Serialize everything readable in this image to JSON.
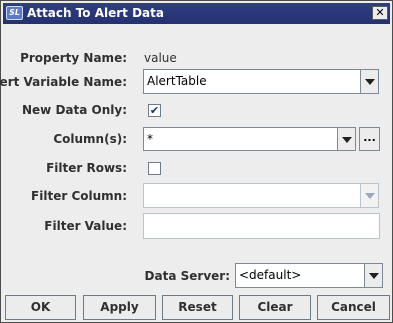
{
  "window": {
    "title": "Attach To Alert Data",
    "app_icon_text": "SL",
    "close_symbol": "✕"
  },
  "form": {
    "property_name_label": "Property Name:",
    "property_name_value": "value",
    "alert_variable_label": "Alert Variable Name:",
    "alert_variable_value": "AlertTable",
    "new_data_only_label": "New Data Only:",
    "new_data_only_checked": true,
    "check_mark": "✔",
    "columns_label": "Column(s):",
    "columns_value": "*",
    "columns_browse": "...",
    "filter_rows_label": "Filter Rows:",
    "filter_rows_checked": false,
    "filter_column_label": "Filter Column:",
    "filter_column_value": "",
    "filter_value_label": "Filter Value:",
    "filter_value_value": "",
    "data_server_label": "Data Server:",
    "data_server_value": "<default>"
  },
  "buttons": {
    "ok": "OK",
    "apply": "Apply",
    "reset": "Reset",
    "clear": "Clear",
    "cancel": "Cancel"
  },
  "colors": {
    "titlebar": "#2f3f83",
    "dialog_bg": "#ededed",
    "field_border": "#7a8a99"
  }
}
